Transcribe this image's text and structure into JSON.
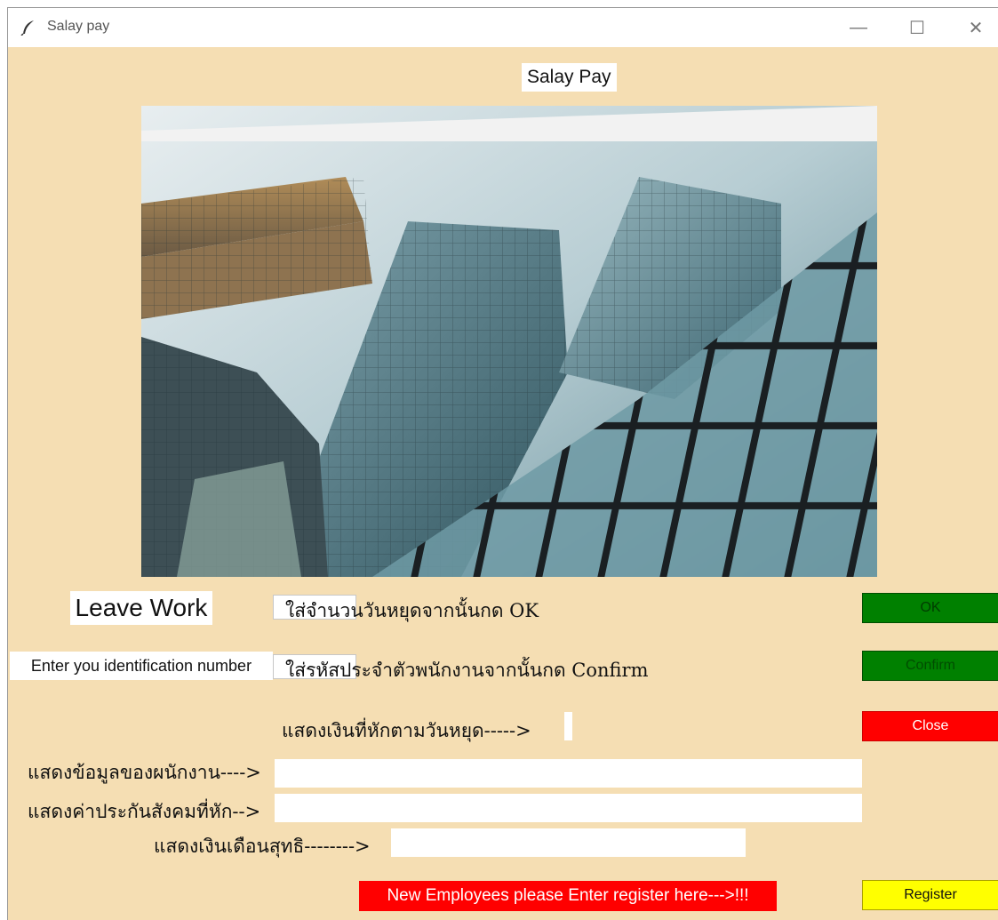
{
  "window": {
    "title": "Salay pay",
    "controls": {
      "minimize": "—",
      "maximize": "☐",
      "close": "✕"
    }
  },
  "heading": "Salay Pay",
  "photo": {
    "description": ""
  },
  "leave": {
    "label": "Leave Work",
    "entry_value": "",
    "hint": "ใส่จำนวนวันหยุดจากนั้นกด OK"
  },
  "identification": {
    "label": "Enter you identification number",
    "entry_value": "",
    "hint": "ใส่รหัสประจำตัวพนักงานจากนั้นกด Confirm"
  },
  "deduction": {
    "label": "แสดงเงินที่หักตามวันหยุด----->",
    "value": ""
  },
  "employee_info": {
    "label": "แสดงข้อมูลของผนักงาน---->",
    "value": ""
  },
  "social_security": {
    "label": "แสดงค่าประกันสังคมที่หัก-->",
    "value": ""
  },
  "net_salary": {
    "label": "แสดงเงินเดือนสุทธิ-------->",
    "value": ""
  },
  "buttons": {
    "ok": "OK",
    "confirm": "Confirm",
    "close": "Close",
    "register": "Register"
  },
  "register_banner": "New Employees please Enter register here--->!!!",
  "colors": {
    "background": "#f5deb3",
    "ok": "#008000",
    "confirm": "#008000",
    "close": "#ff0000",
    "register": "#ffff00",
    "banner": "#ff0000"
  }
}
